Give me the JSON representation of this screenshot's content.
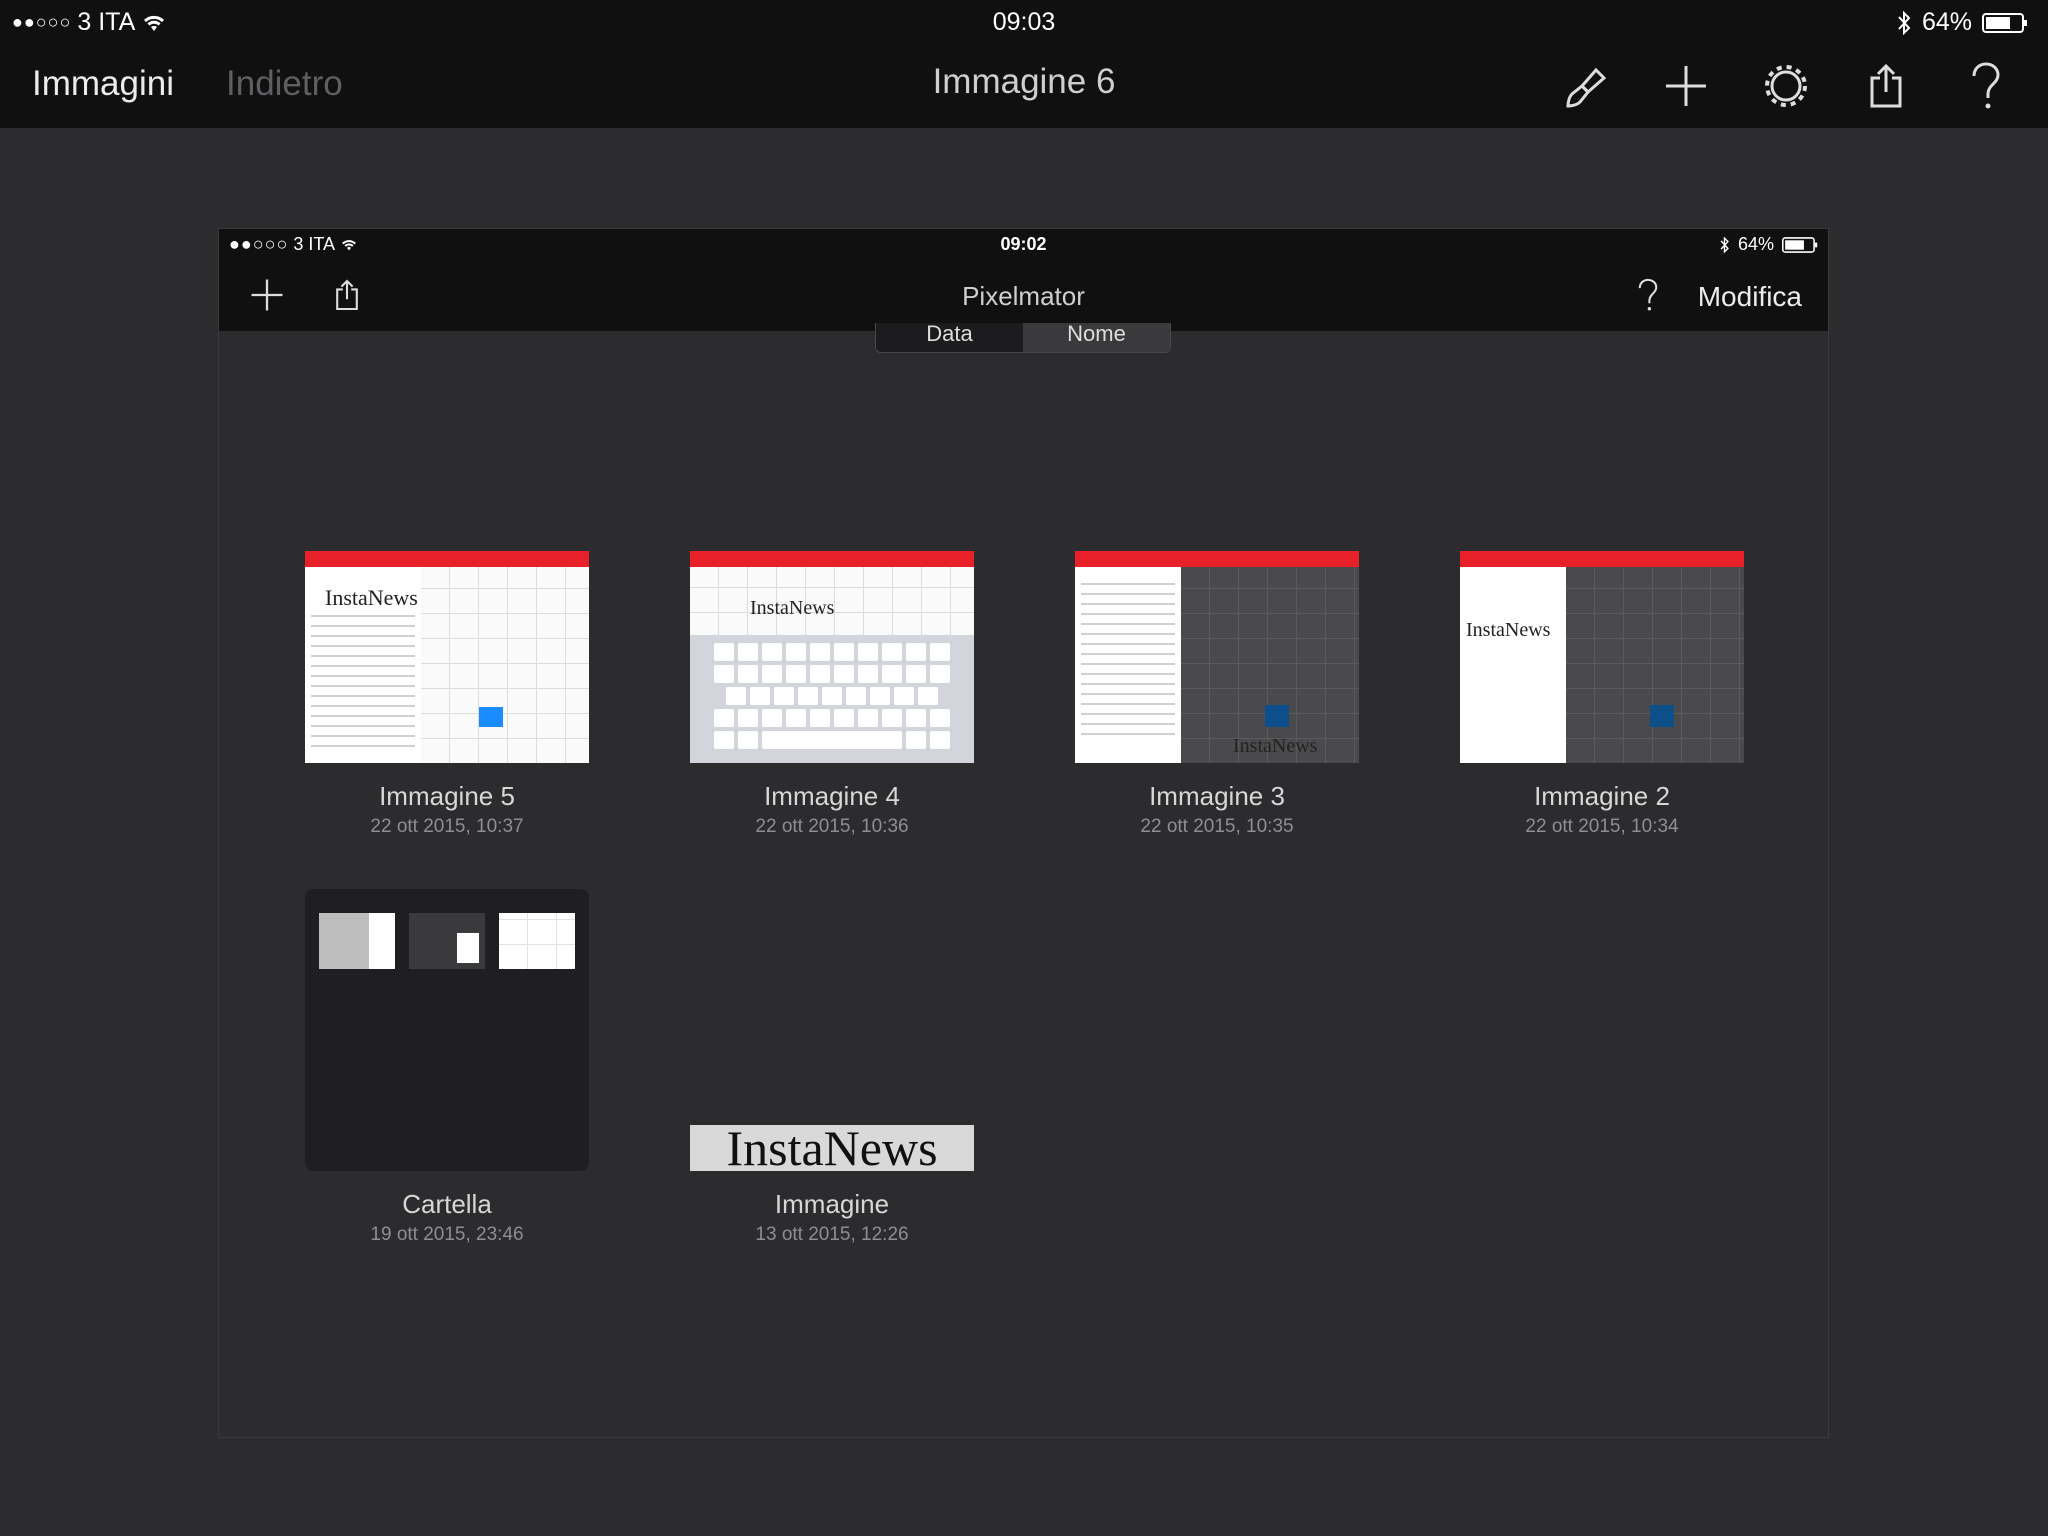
{
  "status_bar": {
    "carrier": "3 ITA",
    "signal_dots": "●●○○○",
    "time": "09:03",
    "battery": "64%"
  },
  "navbar": {
    "back_label": "Immagini",
    "back2_label": "Indietro",
    "title": "Immagine 6"
  },
  "screenshot": {
    "status_bar": {
      "carrier": "3 ITA",
      "signal_dots": "●●○○○",
      "time": "09:02",
      "battery": "64%"
    },
    "navbar": {
      "title": "Pixelmator",
      "edit_label": "Modifica"
    },
    "sort": {
      "option_date": "Data",
      "option_name": "Nome"
    },
    "items": [
      {
        "name": "Immagine 5",
        "date": "22 ott 2015, 10:37",
        "thumb_text": "InstaNews"
      },
      {
        "name": "Immagine 4",
        "date": "22 ott 2015, 10:36",
        "thumb_text": "InstaNews"
      },
      {
        "name": "Immagine 3",
        "date": "22 ott 2015, 10:35",
        "thumb_text": "InstaNews"
      },
      {
        "name": "Immagine 2",
        "date": "22 ott 2015, 10:34",
        "thumb_text": "InstaNews"
      },
      {
        "name": "Cartella",
        "date": "19 ott 2015, 23:46"
      },
      {
        "name": "Immagine",
        "date": "13 ott 2015, 12:26",
        "thumb_text": "InstaNews"
      }
    ]
  },
  "colors": {
    "accent_red": "#e8202a",
    "selection_blue": "#1a8cff",
    "background": "#2c2c2e",
    "bar": "#101010"
  }
}
